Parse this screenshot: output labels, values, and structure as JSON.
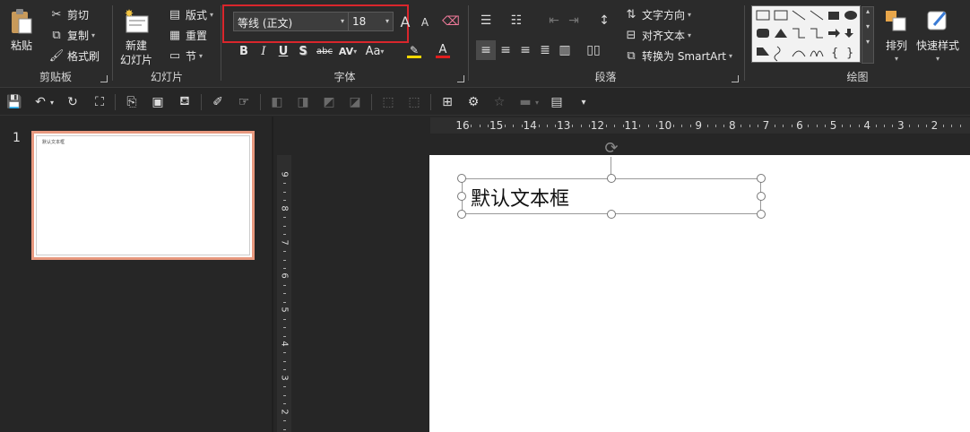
{
  "ribbon": {
    "clipboard": {
      "group_label": "剪贴板",
      "paste_label": "粘贴",
      "cut_label": "剪切",
      "copy_label": "复制",
      "format_painter_label": "格式刷"
    },
    "slides": {
      "group_label": "幻灯片",
      "new_slide_label_line1": "新建",
      "new_slide_label_line2": "幻灯片",
      "layout_label": "版式",
      "reset_label": "重置",
      "section_label": "节"
    },
    "font": {
      "group_label": "字体",
      "font_name": "等线 (正文)",
      "font_size": "18",
      "bold": "B",
      "italic": "I",
      "underline": "U",
      "shadow": "S",
      "strike": "abc",
      "spacing": "AV",
      "change_case": "Aa",
      "grow": "A",
      "shrink": "A",
      "font_color_letter": "A",
      "highlight_color": "#f5d800",
      "font_color": "#e01e1e"
    },
    "paragraph": {
      "group_label": "段落",
      "text_direction_label": "文字方向",
      "align_text_label": "对齐文本",
      "smartart_label": "转换为 SmartArt"
    },
    "drawing": {
      "group_label": "绘图",
      "arrange_label": "排列",
      "quick_styles_label": "快速样式"
    }
  },
  "thumbnails": {
    "slide_number": "1",
    "thumb_text": "默认文本框"
  },
  "rulers": {
    "horizontal": [
      "16",
      "15",
      "14",
      "13",
      "12",
      "11",
      "10",
      "9",
      "8",
      "7",
      "6",
      "5",
      "4",
      "3",
      "2"
    ],
    "vertical": [
      "9",
      "8",
      "7",
      "6",
      "5",
      "4",
      "3",
      "2"
    ]
  },
  "slide": {
    "textbox_text": "默认文本框"
  },
  "colors": {
    "accent_highlight_box": "#d9262c",
    "thumb_selection": "#e8997f"
  }
}
